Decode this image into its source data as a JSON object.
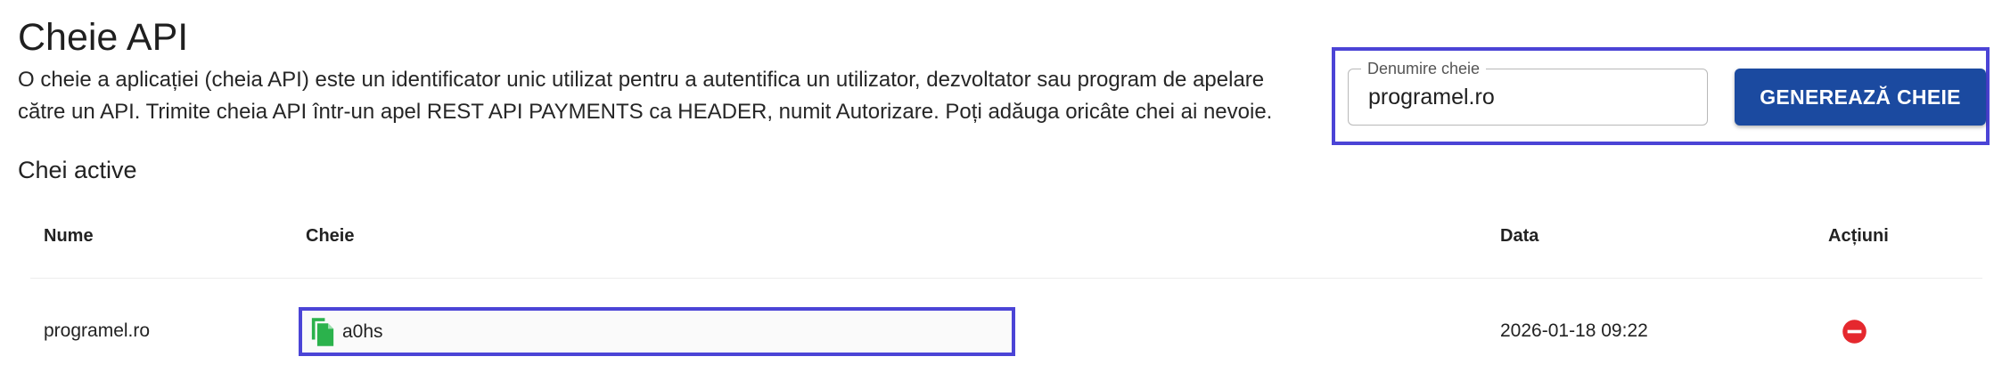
{
  "page": {
    "title": "Cheie API",
    "description_line1": "O cheie a aplicației (cheia API) este un identificator unic utilizat pentru a autentifica un utilizator, dezvoltator sau program de apelare",
    "description_line2": "către un API. Trimite cheia API într-un apel REST API PAYMENTS ca HEADER, numit Autorizare. Poți adăuga oricâte chei ai nevoie."
  },
  "form": {
    "field_label": "Denumire cheie",
    "field_value": "programel.ro",
    "button_label": "GENEREAZĂ CHEIE"
  },
  "section": {
    "title": "Chei active"
  },
  "table": {
    "headers": {
      "name": "Nume",
      "key": "Cheie",
      "date": "Data",
      "actions": "Acțiuni"
    },
    "rows": [
      {
        "name": "programel.ro",
        "key": "a0hs",
        "date": "2026-01-18 09:22",
        "action_icon": "remove-circle-icon"
      }
    ]
  },
  "colors": {
    "accent": "#1b4aa0",
    "highlight_border": "#4b44d6",
    "copy_icon": "#2bb24c",
    "delete_icon": "#e5282e"
  }
}
